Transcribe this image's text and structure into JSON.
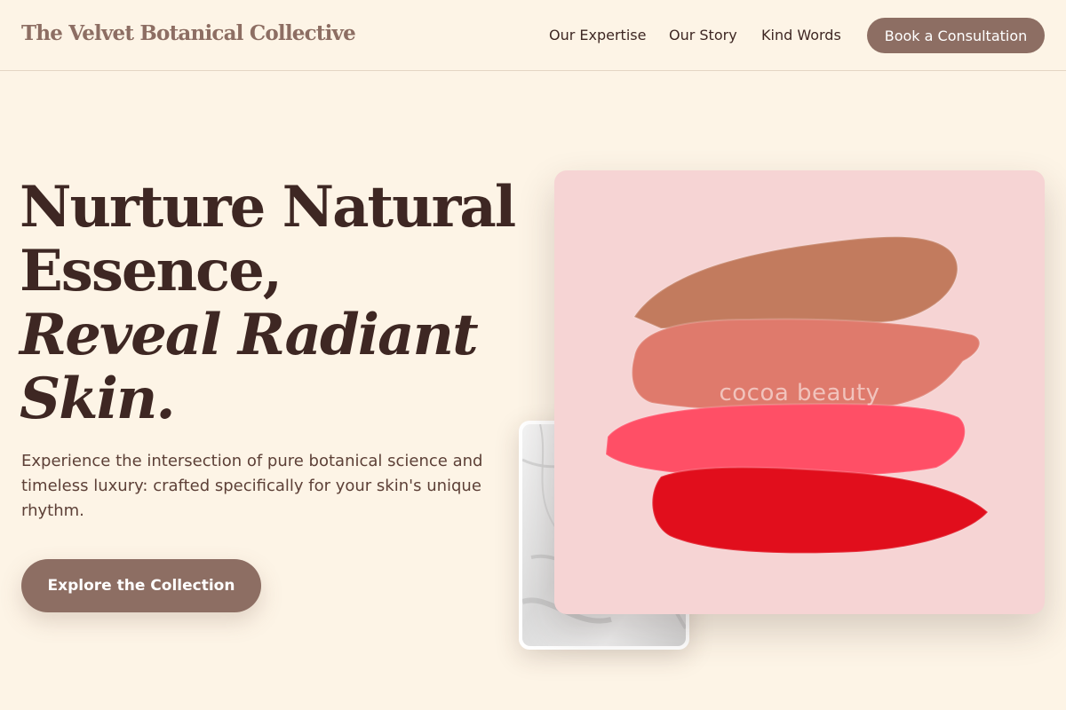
{
  "header": {
    "brand": "The Velvet Botanical Collective",
    "nav": [
      "Our Expertise",
      "Our Story",
      "Kind Words"
    ],
    "cta_label": "Book a Consultation"
  },
  "hero": {
    "title_lines": [
      "Nurture Natural",
      "Essence,"
    ],
    "title_italic_lines": [
      "Reveal Radiant",
      "Skin."
    ],
    "description": "Experience the intersection of pure botanical science and timeless luxury: crafted specifically for your skin's unique rhythm.",
    "cta_label": "Explore the Collection"
  },
  "showcase": {
    "watermark": "cocoa beauty",
    "swatches": [
      "lipstick-swatch-bronze",
      "lipstick-swatch-coral",
      "lipstick-swatch-pink",
      "lipstick-swatch-red"
    ]
  },
  "colors": {
    "background": "#fdf4e6",
    "accent": "#8d6e63",
    "text_dark": "#3e2723",
    "card_pink": "#f6d4d4",
    "swatch_bronze": "#c27b5e",
    "swatch_coral": "#df7a6c",
    "swatch_pink": "#ff4f66",
    "swatch_red": "#e10e1c"
  }
}
